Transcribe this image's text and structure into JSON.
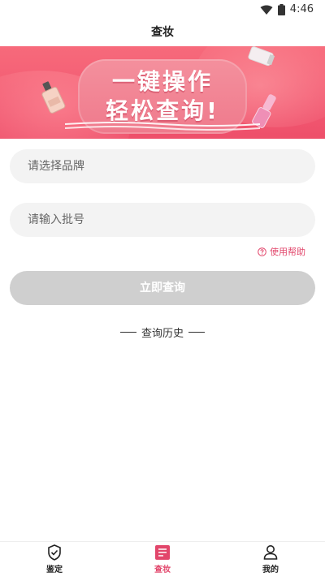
{
  "status_bar": {
    "time": "4:46"
  },
  "header": {
    "title": "查妆"
  },
  "banner": {
    "line1": "一键操作",
    "line2": "轻松查询!"
  },
  "form": {
    "brand_placeholder": "请选择品牌",
    "batch_placeholder": "请输入批号",
    "help_label": "使用帮助",
    "submit_label": "立即查询"
  },
  "history": {
    "label": "查询历史"
  },
  "tabbar": {
    "items": [
      {
        "label": "鉴定",
        "icon": "shield-check-icon",
        "active": false
      },
      {
        "label": "查妆",
        "icon": "makeup-check-icon",
        "active": true
      },
      {
        "label": "我的",
        "icon": "user-icon",
        "active": false
      }
    ]
  },
  "colors": {
    "accent": "#e2466b",
    "banner": "#f25a72",
    "field_bg": "#f3f3f3",
    "button_disabled": "#cfcfcf"
  }
}
